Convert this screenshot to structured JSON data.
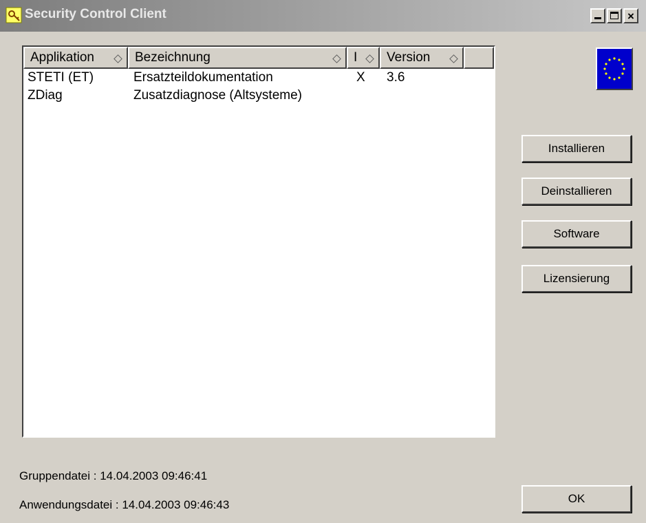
{
  "window": {
    "title": "Security Control Client",
    "close_glyph": "×"
  },
  "listview": {
    "columns": [
      {
        "label": "Applikation"
      },
      {
        "label": "Bezeichnung"
      },
      {
        "label": "I"
      },
      {
        "label": "Version"
      }
    ],
    "rows": [
      {
        "applikation": "STETI (ET)",
        "bezeichnung": "Ersatzteildokumentation",
        "i": "X",
        "version": "3.6"
      },
      {
        "applikation": "ZDiag",
        "bezeichnung": "Zusatzdiagnose (Altsysteme)",
        "i": "",
        "version": ""
      }
    ]
  },
  "buttons": {
    "install": "Installieren",
    "uninstall": "Deinstallieren",
    "software": "Software",
    "licensing": "Lizensierung",
    "ok": "OK"
  },
  "status": {
    "group_file": "Gruppendatei : 14.04.2003  09:46:41",
    "application_file": "Anwendungsdatei : 14.04.2003  09:46:43"
  },
  "colors": {
    "eu_flag_blue": "#0000cc",
    "eu_star_yellow": "#ffff00",
    "dialog_bg": "#d4d0c8"
  },
  "icons": {
    "app": "key-lock-icon",
    "flag": "eu-flag-icon"
  }
}
